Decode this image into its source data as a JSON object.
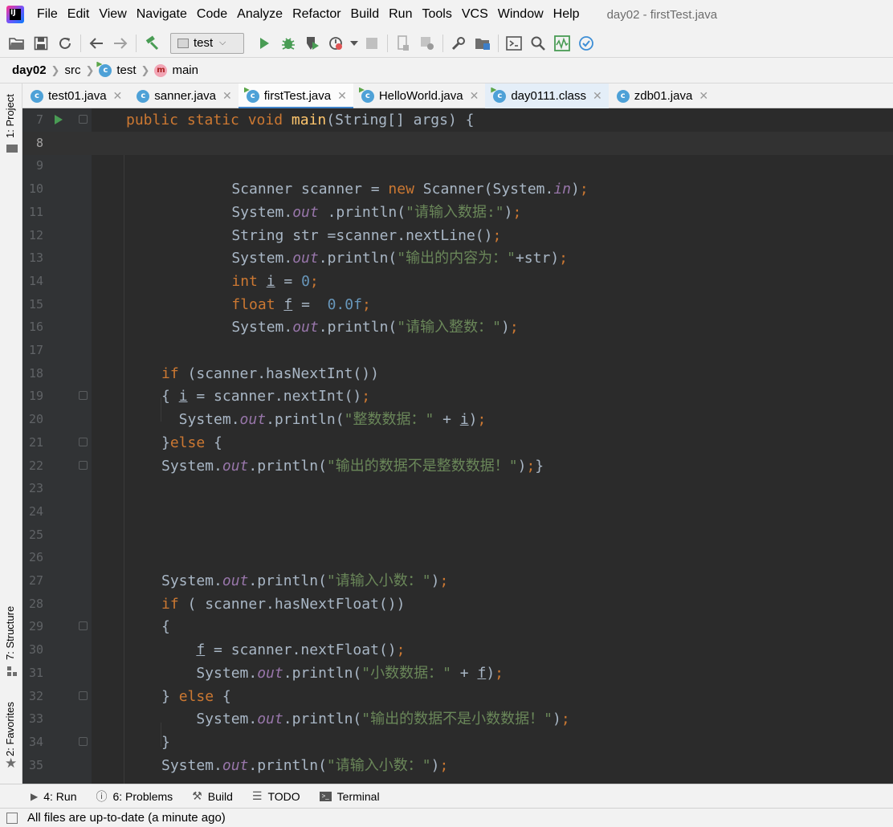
{
  "menubar": {
    "items": [
      "File",
      "Edit",
      "View",
      "Navigate",
      "Code",
      "Analyze",
      "Refactor",
      "Build",
      "Run",
      "Tools",
      "VCS",
      "Window",
      "Help"
    ],
    "window_title": "day02 - firstTest.java"
  },
  "toolbar": {
    "run_config": "test"
  },
  "breadcrumb": {
    "project": "day02",
    "folder": "src",
    "class_name": "test",
    "method_name": "main"
  },
  "left_strip": {
    "project_tab": "1: Project",
    "structure_tab": "7: Structure",
    "favorites_tab": "2: Favorites"
  },
  "tabs": [
    {
      "label": "test01.java",
      "active": false
    },
    {
      "label": "sanner.java",
      "active": false
    },
    {
      "label": "firstTest.java",
      "active": true
    },
    {
      "label": "HelloWorld.java",
      "active": false
    },
    {
      "label": "day0111.class",
      "active": false
    },
    {
      "label": "zdb01.java",
      "active": false
    }
  ],
  "editor": {
    "lines": [
      {
        "n": "7"
      },
      {
        "n": "8"
      },
      {
        "n": "9"
      },
      {
        "n": "10"
      },
      {
        "n": "11"
      },
      {
        "n": "12"
      },
      {
        "n": "13"
      },
      {
        "n": "14"
      },
      {
        "n": "15"
      },
      {
        "n": "16"
      },
      {
        "n": "17"
      },
      {
        "n": "18"
      },
      {
        "n": "19"
      },
      {
        "n": "20"
      },
      {
        "n": "21"
      },
      {
        "n": "22"
      },
      {
        "n": "23"
      },
      {
        "n": "24"
      },
      {
        "n": "25"
      },
      {
        "n": "26"
      },
      {
        "n": "27"
      },
      {
        "n": "28"
      },
      {
        "n": "29"
      },
      {
        "n": "30"
      },
      {
        "n": "31"
      },
      {
        "n": "32"
      },
      {
        "n": "33"
      },
      {
        "n": "34"
      },
      {
        "n": "35"
      }
    ],
    "code": [
      [
        {
          "t": "public static void ",
          "c": "kw"
        },
        {
          "t": "main",
          "c": "fn"
        },
        {
          "t": "(String[] args) {"
        }
      ],
      [],
      [],
      [
        {
          "t": "    Scanner scanner = "
        },
        {
          "t": "new ",
          "c": "kw"
        },
        {
          "t": "Scanner(System."
        },
        {
          "t": "in",
          "c": "fld"
        },
        {
          "t": ")"
        },
        {
          "t": ";",
          "c": "kw"
        }
      ],
      [
        {
          "t": "    System."
        },
        {
          "t": "out",
          "c": "fld"
        },
        {
          "t": " .println("
        },
        {
          "t": "\"请输入数据:\"",
          "c": "str"
        },
        {
          "t": ")"
        },
        {
          "t": ";",
          "c": "kw"
        }
      ],
      [
        {
          "t": "    String str =scanner.nextLine()"
        },
        {
          "t": ";",
          "c": "kw"
        }
      ],
      [
        {
          "t": "    System."
        },
        {
          "t": "out",
          "c": "fld"
        },
        {
          "t": ".println("
        },
        {
          "t": "\"输出的内容为：\"",
          "c": "str"
        },
        {
          "t": "+str)"
        },
        {
          "t": ";",
          "c": "kw"
        }
      ],
      [
        {
          "t": "    "
        },
        {
          "t": "int ",
          "c": "kw"
        },
        {
          "t": "i",
          "c": "lv"
        },
        {
          "t": " = "
        },
        {
          "t": "0",
          "c": "num"
        },
        {
          "t": ";",
          "c": "kw"
        }
      ],
      [
        {
          "t": "    "
        },
        {
          "t": "float ",
          "c": "kw"
        },
        {
          "t": "f",
          "c": "lv"
        },
        {
          "t": " =  "
        },
        {
          "t": "0.0f",
          "c": "num"
        },
        {
          "t": ";",
          "c": "kw"
        }
      ],
      [
        {
          "t": "    System."
        },
        {
          "t": "out",
          "c": "fld"
        },
        {
          "t": ".println("
        },
        {
          "t": "\"请输入整数：\"",
          "c": "str"
        },
        {
          "t": ")"
        },
        {
          "t": ";",
          "c": "kw"
        }
      ],
      [],
      [
        {
          "t": "if ",
          "c": "kw"
        },
        {
          "t": "(scanner.hasNextInt())"
        }
      ],
      [
        {
          "t": "{ "
        },
        {
          "t": "i",
          "c": "lv"
        },
        {
          "t": " = scanner.nextInt()"
        },
        {
          "t": ";",
          "c": "kw"
        }
      ],
      [
        {
          "t": "  System."
        },
        {
          "t": "out",
          "c": "fld"
        },
        {
          "t": ".println("
        },
        {
          "t": "\"整数数据：\"",
          "c": "str"
        },
        {
          "t": " + "
        },
        {
          "t": "i",
          "c": "lv"
        },
        {
          "t": ")"
        },
        {
          "t": ";",
          "c": "kw"
        }
      ],
      [
        {
          "t": "}"
        },
        {
          "t": "else ",
          "c": "kw"
        },
        {
          "t": "{"
        }
      ],
      [
        {
          "t": "System."
        },
        {
          "t": "out",
          "c": "fld"
        },
        {
          "t": ".println("
        },
        {
          "t": "\"输出的数据不是整数数据！\"",
          "c": "str"
        },
        {
          "t": ")"
        },
        {
          "t": ";",
          "c": "kw"
        },
        {
          "t": "}"
        }
      ],
      [],
      [],
      [],
      [],
      [
        {
          "t": "System."
        },
        {
          "t": "out",
          "c": "fld"
        },
        {
          "t": ".println("
        },
        {
          "t": "\"请输入小数：\"",
          "c": "str"
        },
        {
          "t": ")"
        },
        {
          "t": ";",
          "c": "kw"
        }
      ],
      [
        {
          "t": "if ",
          "c": "kw"
        },
        {
          "t": "( scanner.hasNextFloat())"
        }
      ],
      [
        {
          "t": "{"
        }
      ],
      [
        {
          "t": "    "
        },
        {
          "t": "f",
          "c": "lv"
        },
        {
          "t": " = scanner.nextFloat()"
        },
        {
          "t": ";",
          "c": "kw"
        }
      ],
      [
        {
          "t": "    System."
        },
        {
          "t": "out",
          "c": "fld"
        },
        {
          "t": ".println("
        },
        {
          "t": "\"小数数据：\"",
          "c": "str"
        },
        {
          "t": " + "
        },
        {
          "t": "f",
          "c": "lv"
        },
        {
          "t": ")"
        },
        {
          "t": ";",
          "c": "kw"
        }
      ],
      [
        {
          "t": "} "
        },
        {
          "t": "else ",
          "c": "kw"
        },
        {
          "t": "{"
        }
      ],
      [
        {
          "t": "    System."
        },
        {
          "t": "out",
          "c": "fld"
        },
        {
          "t": ".println("
        },
        {
          "t": "\"输出的数据不是小数数据！\"",
          "c": "str"
        },
        {
          "t": ")"
        },
        {
          "t": ";",
          "c": "kw"
        }
      ],
      [
        {
          "t": "}"
        }
      ],
      [
        {
          "t": "System."
        },
        {
          "t": "out",
          "c": "fld"
        },
        {
          "t": ".println("
        },
        {
          "t": "\"请输入小数：\"",
          "c": "str"
        },
        {
          "t": ")"
        },
        {
          "t": ";",
          "c": "kw"
        }
      ]
    ]
  },
  "bottom_tools": {
    "run": "4: Run",
    "problems": "6: Problems",
    "build": "Build",
    "todo": "TODO",
    "terminal": "Terminal"
  },
  "statusbar": {
    "message": "All files are up-to-date (a minute ago)"
  }
}
